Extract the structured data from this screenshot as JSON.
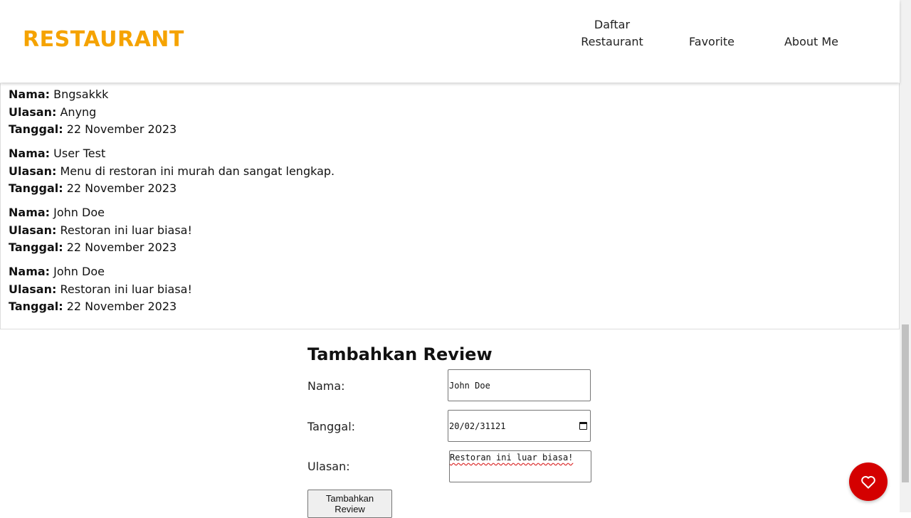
{
  "header": {
    "logo": "RESTAURANT",
    "nav": [
      "Daftar\nRestaurant",
      "Favorite",
      "About Me"
    ]
  },
  "reviews": [
    {
      "name": "Bngsakkk",
      "review": "Anyng",
      "date": "22 November 2023"
    },
    {
      "name": "User Test",
      "review": "Menu di restoran ini murah dan sangat lengkap.",
      "date": "22 November 2023"
    },
    {
      "name": "John Doe",
      "review": "Restoran ini luar biasa!",
      "date": "22 November 2023"
    },
    {
      "name": "John Doe",
      "review": "Restoran ini luar biasa!",
      "date": "22 November 2023"
    }
  ],
  "review_labels": {
    "name": "Nama:",
    "review": "Ulasan:",
    "date": "Tanggal:"
  },
  "form": {
    "title": "Tambahkan Review",
    "name_label": "Nama:",
    "name_value": "John Doe",
    "date_label": "Tanggal:",
    "date_value": "20/02/31121",
    "review_label": "Ulasan:",
    "review_value": "Restoran ini luar biasa!",
    "submit_label": "Tambahkan Review"
  },
  "colors": {
    "brand": "#f5a300",
    "fab": "#d40000"
  },
  "icons": {
    "fab": "heart-icon",
    "date": "calendar-icon"
  }
}
